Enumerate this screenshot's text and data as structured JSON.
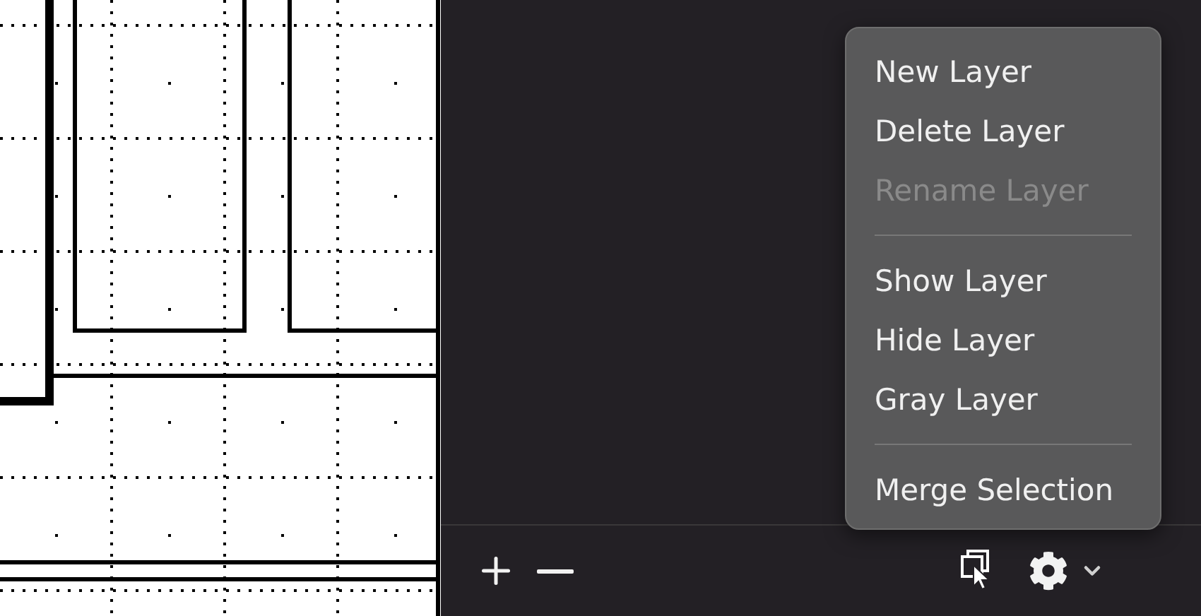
{
  "menu": {
    "items": [
      {
        "kind": "item",
        "label": "New Layer",
        "disabled": false
      },
      {
        "kind": "item",
        "label": "Delete Layer",
        "disabled": false
      },
      {
        "kind": "item",
        "label": "Rename Layer",
        "disabled": true
      },
      {
        "kind": "separator"
      },
      {
        "kind": "item",
        "label": "Show Layer",
        "disabled": false
      },
      {
        "kind": "item",
        "label": "Hide Layer",
        "disabled": false
      },
      {
        "kind": "item",
        "label": "Gray Layer",
        "disabled": false
      },
      {
        "kind": "separator"
      },
      {
        "kind": "item",
        "label": "Merge Selection",
        "disabled": false
      }
    ]
  }
}
